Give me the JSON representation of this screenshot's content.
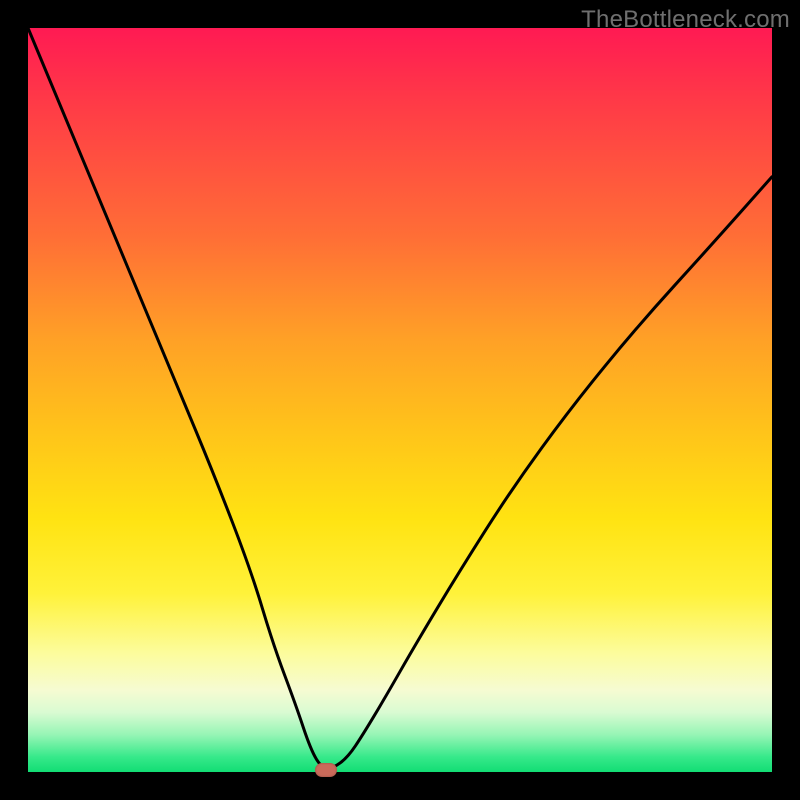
{
  "watermark": "TheBottleneck.com",
  "chart_data": {
    "type": "line",
    "title": "",
    "xlabel": "",
    "ylabel": "",
    "xlim": [
      0,
      100
    ],
    "ylim": [
      0,
      100
    ],
    "grid": false,
    "legend": false,
    "background_gradient": {
      "from": "#ff1a53",
      "mid": "#ffe312",
      "to": "#12dd74",
      "direction": "top-to-bottom"
    },
    "series": [
      {
        "name": "bottleneck-curve",
        "color": "#000000",
        "x": [
          0,
          5,
          10,
          15,
          20,
          25,
          30,
          33,
          36,
          38,
          39.5,
          41,
          43,
          45,
          48,
          52,
          58,
          65,
          73,
          82,
          92,
          100
        ],
        "y": [
          100,
          88,
          76,
          64,
          52,
          40,
          27,
          17,
          9,
          3,
          0.5,
          0.5,
          2,
          5,
          10,
          17,
          27,
          38,
          49,
          60,
          71,
          80
        ]
      }
    ],
    "marker": {
      "name": "optimal-point",
      "x": 40,
      "y": 0,
      "color": "#c96a5a"
    }
  }
}
